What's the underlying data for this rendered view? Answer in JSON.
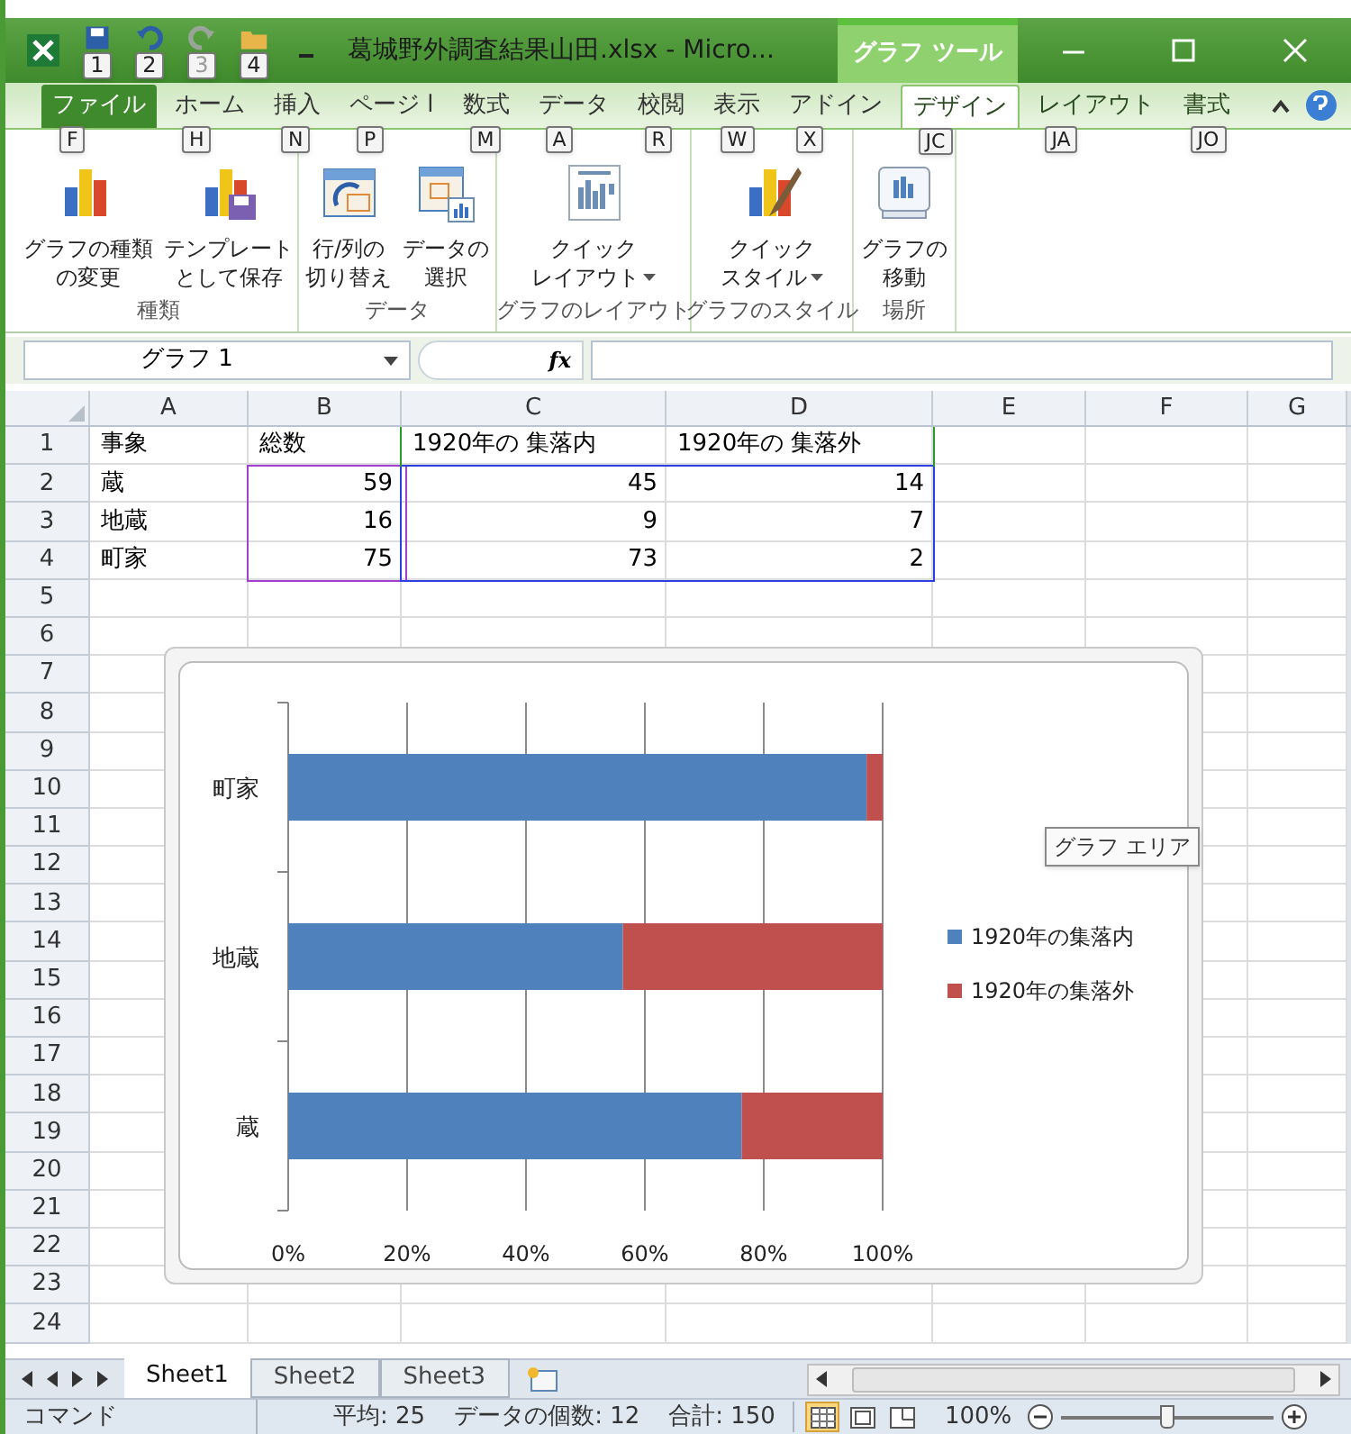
{
  "title_bar": {
    "title": "葛城野外調査結果山田.xlsx - Micro...",
    "context_tab": "グラフ ツール",
    "quick_access": [
      {
        "keytip": "1",
        "kind": "save",
        "disabled": false
      },
      {
        "keytip": "2",
        "kind": "undo",
        "disabled": false
      },
      {
        "keytip": "3",
        "kind": "redo",
        "disabled": true
      },
      {
        "keytip": "4",
        "kind": "open",
        "disabled": false
      }
    ]
  },
  "ribbon_tabs": [
    {
      "label": "ファイル",
      "keytip": "F",
      "kind": "file",
      "selected": false
    },
    {
      "label": "ホーム",
      "keytip": "H",
      "kind": "normal",
      "selected": false
    },
    {
      "label": "挿入",
      "keytip": "N",
      "kind": "normal",
      "selected": false
    },
    {
      "label": "ページ l",
      "keytip": "P",
      "kind": "normal",
      "selected": false
    },
    {
      "label": "数式",
      "keytip": "M",
      "kind": "normal",
      "selected": false
    },
    {
      "label": "データ",
      "keytip": "A",
      "kind": "normal",
      "selected": false
    },
    {
      "label": "校閲",
      "keytip": "R",
      "kind": "normal",
      "selected": false
    },
    {
      "label": "表示",
      "keytip": "W",
      "kind": "normal",
      "selected": false
    },
    {
      "label": "アドイン",
      "keytip": "X",
      "kind": "normal",
      "selected": false
    },
    {
      "label": "デザイン",
      "keytip": "JC",
      "kind": "context",
      "selected": true
    },
    {
      "label": "レイアウト",
      "keytip": "JA",
      "kind": "context",
      "selected": false
    },
    {
      "label": "書式",
      "keytip": "JO",
      "kind": "context",
      "selected": false
    }
  ],
  "ribbon_groups": [
    {
      "label": "種類",
      "buttons": [
        {
          "lines": [
            "グラフの種類",
            "の変更"
          ],
          "kind": "chart-type",
          "dropdown": false
        },
        {
          "lines": [
            "テンプレート",
            "として保存"
          ],
          "kind": "template",
          "dropdown": false
        }
      ]
    },
    {
      "label": "データ",
      "buttons": [
        {
          "lines": [
            "行/列の",
            "切り替え"
          ],
          "kind": "switch",
          "dropdown": false
        },
        {
          "lines": [
            "データの",
            "選択"
          ],
          "kind": "select-data",
          "dropdown": false
        }
      ]
    },
    {
      "label": "グラフのレイアウト",
      "buttons": [
        {
          "lines": [
            "クイック",
            "レイアウト"
          ],
          "kind": "quick-layout",
          "dropdown": true
        }
      ]
    },
    {
      "label": "グラフのスタイル",
      "buttons": [
        {
          "lines": [
            "クイック",
            "スタイル"
          ],
          "kind": "quick-style",
          "dropdown": true
        }
      ]
    },
    {
      "label": "場所",
      "buttons": [
        {
          "lines": [
            "グラフの",
            "移動"
          ],
          "kind": "move",
          "dropdown": false
        }
      ]
    }
  ],
  "formula_bar": {
    "name_box": "グラフ 1",
    "fx": "fx"
  },
  "sheet": {
    "columns": [
      "A",
      "B",
      "C",
      "D",
      "E",
      "F",
      "G"
    ],
    "rows": [
      {
        "number": "1",
        "cells": [
          {
            "text": "事象",
            "kind": "text"
          },
          {
            "text": "総数",
            "kind": "text"
          },
          {
            "text": "1920年の 集落内",
            "kind": "text"
          },
          {
            "text": "1920年の 集落外",
            "kind": "text"
          }
        ]
      },
      {
        "number": "2",
        "cells": [
          {
            "text": "蔵",
            "kind": "text"
          },
          {
            "text": "59",
            "kind": "number"
          },
          {
            "text": "45",
            "kind": "number"
          },
          {
            "text": "14",
            "kind": "number"
          }
        ]
      },
      {
        "number": "3",
        "cells": [
          {
            "text": "地蔵",
            "kind": "text"
          },
          {
            "text": "16",
            "kind": "number"
          },
          {
            "text": "9",
            "kind": "number"
          },
          {
            "text": "7",
            "kind": "number"
          }
        ]
      },
      {
        "number": "4",
        "cells": [
          {
            "text": "町家",
            "kind": "text"
          },
          {
            "text": "75",
            "kind": "number"
          },
          {
            "text": "73",
            "kind": "number"
          },
          {
            "text": "2",
            "kind": "number"
          }
        ]
      },
      {
        "number": "5",
        "cells": []
      },
      {
        "number": "6",
        "cells": []
      },
      {
        "number": "7",
        "cells": []
      },
      {
        "number": "8",
        "cells": []
      },
      {
        "number": "9",
        "cells": []
      },
      {
        "number": "10",
        "cells": []
      },
      {
        "number": "11",
        "cells": []
      },
      {
        "number": "12",
        "cells": []
      },
      {
        "number": "13",
        "cells": []
      },
      {
        "number": "14",
        "cells": []
      },
      {
        "number": "15",
        "cells": []
      },
      {
        "number": "16",
        "cells": []
      },
      {
        "number": "17",
        "cells": []
      },
      {
        "number": "18",
        "cells": []
      },
      {
        "number": "19",
        "cells": []
      },
      {
        "number": "20",
        "cells": []
      },
      {
        "number": "21",
        "cells": []
      },
      {
        "number": "22",
        "cells": []
      },
      {
        "number": "23",
        "cells": []
      },
      {
        "number": "24",
        "cells": []
      }
    ]
  },
  "chart": {
    "tooltip": "グラフ エリア",
    "chart_data": {
      "type": "bar",
      "orientation": "horizontal",
      "stacked": true,
      "categories": [
        "町家",
        "地蔵",
        "蔵"
      ],
      "series": [
        {
          "name": "1920年の集落内",
          "color": "#4f81bd",
          "values": [
            97.3,
            56.3,
            76.3
          ]
        },
        {
          "name": "1920年の集落外",
          "color": "#c0504d",
          "values": [
            2.7,
            43.7,
            23.7
          ]
        }
      ],
      "grid": true,
      "legend": true,
      "xlim": [
        0,
        100
      ],
      "xticks": [
        {
          "value": 0,
          "label": "0%"
        },
        {
          "value": 20,
          "label": "20%"
        },
        {
          "value": 40,
          "label": "40%"
        },
        {
          "value": 60,
          "label": "60%"
        },
        {
          "value": 80,
          "label": "80%"
        },
        {
          "value": 100,
          "label": "100%"
        }
      ]
    }
  },
  "sheet_tabs": [
    {
      "label": "Sheet1",
      "selected": true
    },
    {
      "label": "Sheet2",
      "selected": false
    },
    {
      "label": "Sheet3",
      "selected": false
    }
  ],
  "status_bar": {
    "mode": "コマンド",
    "average": "平均: 25",
    "count": "データの個数: 12",
    "sum": "合計: 150",
    "views": [
      {
        "kind": "normal",
        "selected": true
      },
      {
        "kind": "page-layout",
        "selected": false
      },
      {
        "kind": "page-break",
        "selected": false
      }
    ],
    "zoom": "100%",
    "zoom_slider": {
      "level": 0.5
    }
  }
}
